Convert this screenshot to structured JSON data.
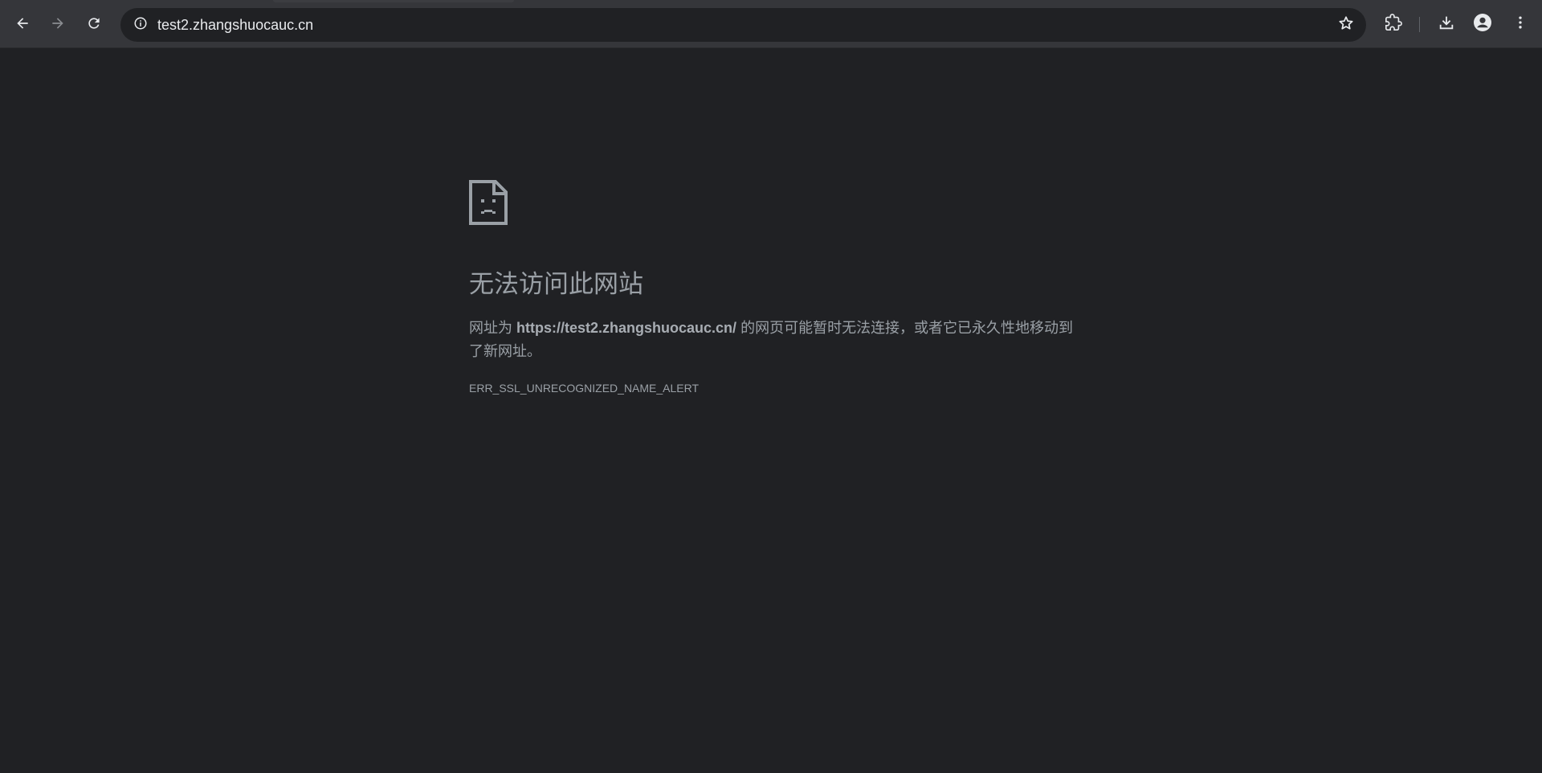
{
  "browser": {
    "address_bar": {
      "url": "test2.zhangshuocauc.cn"
    },
    "icons": {
      "back": "arrow-left-icon",
      "forward": "arrow-right-icon",
      "reload": "reload-icon",
      "site_info": "info-circle-icon",
      "bookmark": "star-icon",
      "extensions": "puzzle-icon",
      "downloads": "download-icon",
      "profile": "account-icon",
      "menu": "more-vert-icon"
    }
  },
  "error_page": {
    "icon": "sad-page-icon",
    "title": "无法访问此网站",
    "description_prefix": "网址为 ",
    "description_url": "https://test2.zhangshuocauc.cn/",
    "description_suffix": " 的网页可能暂时无法连接，或者它已永久性地移动到了新网址。",
    "error_code": "ERR_SSL_UNRECOGNIZED_NAME_ALERT"
  },
  "colors": {
    "background": "#202124",
    "toolbar": "#35363a",
    "omnibox": "#202124",
    "text_muted": "#9aa0a6",
    "text_primary": "#e8eaed"
  }
}
